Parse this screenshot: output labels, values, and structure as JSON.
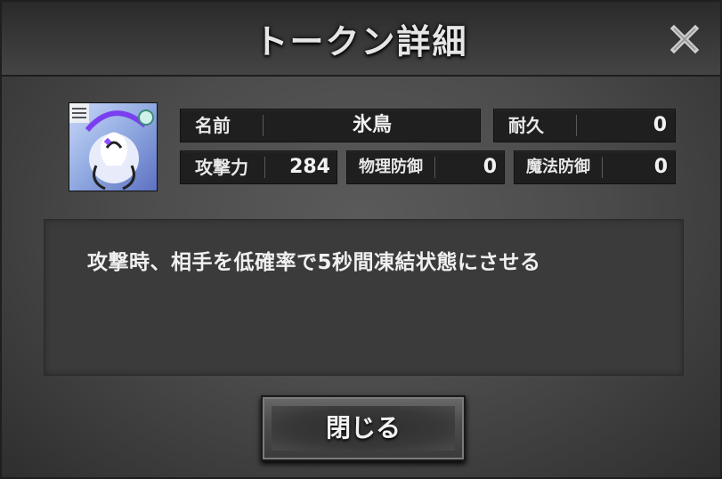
{
  "dialog": {
    "title": "トークン詳細",
    "close_icon": "close-x-icon"
  },
  "token": {
    "portrait_icon": "ice-bird-portrait-icon"
  },
  "stats": {
    "name_label": "名前",
    "name_value": "氷鳥",
    "durability_label": "耐久",
    "durability_value": "0",
    "attack_label": "攻撃力",
    "attack_value": "284",
    "physical_def_label": "物理防御",
    "physical_def_value": "0",
    "magic_def_label": "魔法防御",
    "magic_def_value": "0"
  },
  "description": "攻撃時、相手を低確率で5秒間凍結状態にさせる",
  "footer": {
    "close_label": "閉じる"
  },
  "colors": {
    "stat_bg": "#1f1f1f",
    "portrait_accent": "#8a4fff",
    "portrait_bg": "#9fb8e8"
  }
}
